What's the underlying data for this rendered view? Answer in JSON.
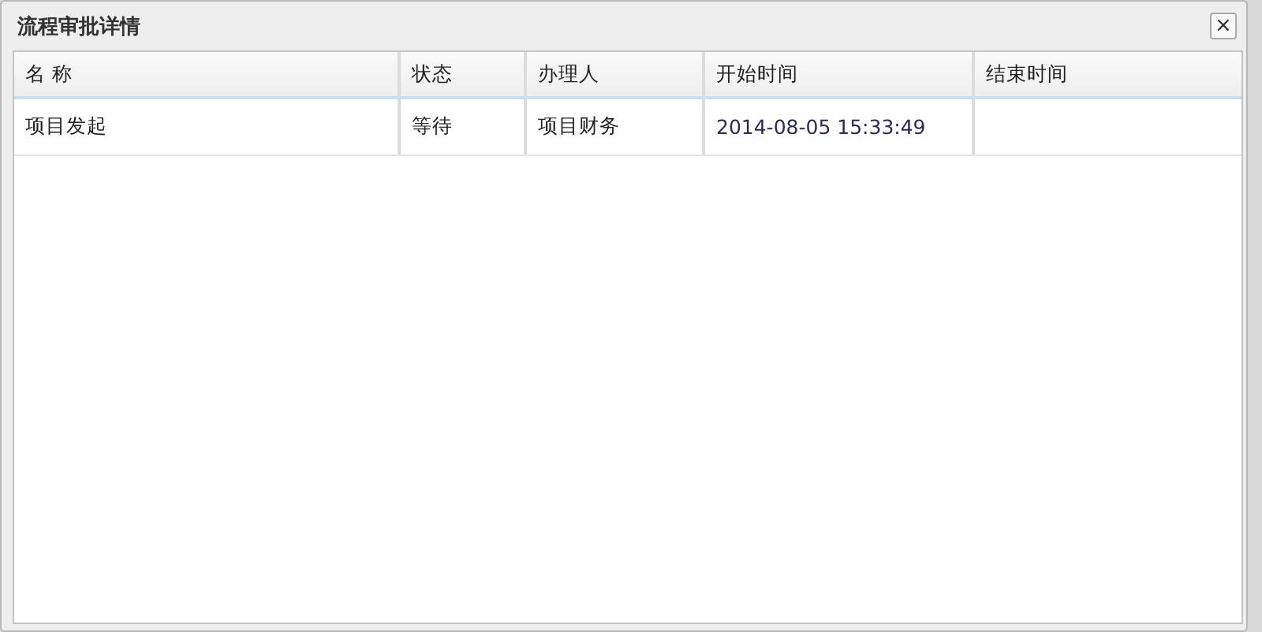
{
  "dialog": {
    "title": "流程审批详情",
    "close": "×"
  },
  "table": {
    "columns": [
      "名 称",
      "状态",
      "办理人",
      "开始时间",
      "结束时间"
    ],
    "rows": [
      [
        "项目发起",
        "等待",
        "项目财务",
        "2014-08-05 15:33:49"
      ]
    ]
  }
}
